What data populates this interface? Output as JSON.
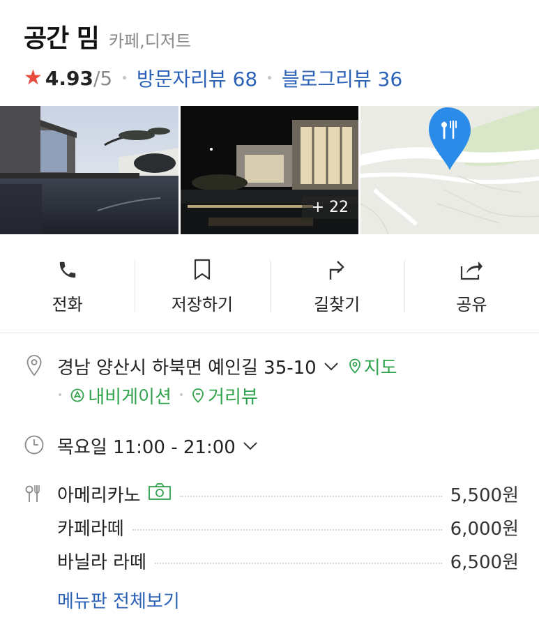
{
  "place": {
    "name": "공간 밈",
    "category": "카페,디저트"
  },
  "rating": {
    "score": "4.93",
    "max": "/5",
    "visitor_reviews": "방문자리뷰 68",
    "blog_reviews": "블로그리뷰 36"
  },
  "gallery": {
    "more_count": "+ 22"
  },
  "actions": [
    {
      "label": "전화",
      "icon": "phone-icon"
    },
    {
      "label": "저장하기",
      "icon": "bookmark-icon"
    },
    {
      "label": "길찾기",
      "icon": "directions-icon"
    },
    {
      "label": "공유",
      "icon": "share-icon"
    }
  ],
  "address": {
    "text": "경남 양산시 하북면 예인길 35-10",
    "map_link": "지도",
    "navigation_link": "내비게이션",
    "streetview_link": "거리뷰"
  },
  "hours": {
    "text": "목요일 11:00 - 21:00"
  },
  "menu": {
    "items": [
      {
        "name": "아메리카노",
        "price": "5,500원",
        "has_photo": true
      },
      {
        "name": "카페라떼",
        "price": "6,000원",
        "has_photo": false
      },
      {
        "name": "바닐라 라떼",
        "price": "6,500원",
        "has_photo": false
      }
    ],
    "view_all": "메뉴판 전체보기"
  },
  "colors": {
    "link_blue": "#2b62b8",
    "link_green": "#31a24c",
    "star_red": "#e74c3c",
    "map_pin": "#2a8be8"
  }
}
